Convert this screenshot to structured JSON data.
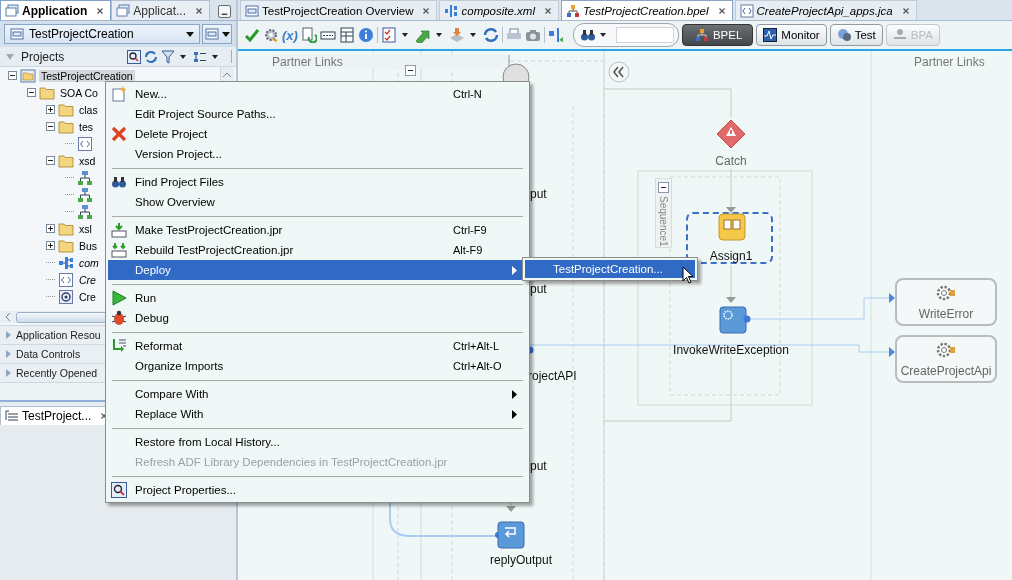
{
  "left_panel": {
    "tabs": [
      {
        "label": "Application",
        "selected": true
      },
      {
        "label": "Applicat...",
        "selected": false
      }
    ],
    "application_selector": {
      "value": "TestProjectCreation"
    },
    "projects_header": {
      "title": "Projects"
    },
    "tree": [
      {
        "label": "TestProjectCreation",
        "kind": "project",
        "expanded": true,
        "selected": true,
        "italic": false,
        "children": [
          {
            "label": "SOA Co",
            "kind": "folder",
            "expanded": true,
            "selected": false,
            "italic": false,
            "children": [
              {
                "label": "clas",
                "kind": "folder",
                "expanded": false,
                "selected": false,
                "italic": false
              },
              {
                "label": "tes",
                "kind": "folder",
                "expanded": true,
                "selected": false,
                "italic": false,
                "children": [
                  {
                    "kind": "source"
                  }
                ]
              },
              {
                "label": "xsd",
                "kind": "folder",
                "expanded": true,
                "selected": false,
                "italic": false,
                "children": [
                  {
                    "kind": "schema"
                  },
                  {
                    "kind": "schema"
                  },
                  {
                    "kind": "schema"
                  }
                ]
              },
              {
                "label": "xsl",
                "kind": "folder",
                "expanded": false,
                "selected": false,
                "italic": false
              },
              {
                "label": "Bus",
                "kind": "folder",
                "expanded": false,
                "selected": false,
                "italic": false
              },
              {
                "label": "com",
                "kind": "composite",
                "selected": false,
                "italic": true
              },
              {
                "label": "Cre",
                "kind": "source",
                "selected": false,
                "italic": true
              },
              {
                "label": "Cre",
                "kind": "adapter",
                "selected": false,
                "italic": false
              }
            ]
          }
        ]
      }
    ],
    "accordion": [
      {
        "label": "Application Resou",
        "expanded": false
      },
      {
        "label": "Data Controls",
        "expanded": false
      },
      {
        "label": "Recently Opened",
        "expanded": false
      }
    ]
  },
  "structure_panel": {
    "tab": "TestProject..."
  },
  "editor": {
    "tabs": [
      {
        "label": "TestProjectCreation Overview",
        "selected": false,
        "italic": false
      },
      {
        "label": "composite.xml",
        "selected": false,
        "italic": true
      },
      {
        "label": "TestProjectCreation.bpel",
        "selected": true,
        "italic": true
      },
      {
        "label": "CreateProjectApi_apps.jca",
        "selected": false,
        "italic": true
      }
    ],
    "toolbar": {
      "variables_label": "(x)",
      "view_buttons": [
        {
          "label": "BPEL",
          "selected": true,
          "disabled": false
        },
        {
          "label": "Monitor",
          "selected": false,
          "disabled": false
        },
        {
          "label": "Test",
          "selected": false,
          "disabled": false
        },
        {
          "label": "BPA",
          "selected": false,
          "disabled": true
        }
      ]
    },
    "canvas": {
      "partner_links_left": {
        "title": "Partner Links"
      },
      "partner_links_right": {
        "title": "Partner Links",
        "items": [
          {
            "label": "WriteError"
          },
          {
            "label": "CreateProjectApi"
          }
        ]
      },
      "partial_labels": [
        "put",
        "put",
        "rojectAPI",
        "put"
      ],
      "catch": {
        "label": "Catch"
      },
      "sequence": {
        "label": "Sequence1",
        "expanded": true
      },
      "assign": {
        "label": "Assign1",
        "selected": true
      },
      "invoke": {
        "label": "InvokeWriteException"
      },
      "reply": {
        "label": "replyOutput"
      }
    }
  },
  "context_menu": {
    "items": [
      {
        "kind": "item",
        "label": "New...",
        "shortcut": "Ctrl-N",
        "selected": false,
        "disabled": false,
        "submenu": false
      },
      {
        "kind": "item",
        "label": "Edit Project Source Paths...",
        "selected": false,
        "disabled": false,
        "submenu": false
      },
      {
        "kind": "item",
        "label": "Delete Project",
        "selected": false,
        "disabled": false,
        "submenu": false
      },
      {
        "kind": "item",
        "label": "Version Project...",
        "selected": false,
        "disabled": false,
        "submenu": false
      },
      {
        "kind": "separator"
      },
      {
        "kind": "item",
        "label": "Find Project Files",
        "selected": false,
        "disabled": false,
        "submenu": false
      },
      {
        "kind": "item",
        "label": "Show Overview",
        "selected": false,
        "disabled": false,
        "submenu": false
      },
      {
        "kind": "separator"
      },
      {
        "kind": "item",
        "label": "Make TestProjectCreation.jpr",
        "shortcut": "Ctrl-F9",
        "selected": false,
        "disabled": false,
        "submenu": false
      },
      {
        "kind": "item",
        "label": "Rebuild TestProjectCreation.jpr",
        "shortcut": "Alt-F9",
        "selected": false,
        "disabled": false,
        "submenu": false
      },
      {
        "kind": "item",
        "label": "Deploy",
        "selected": true,
        "disabled": false,
        "submenu": true
      },
      {
        "kind": "separator"
      },
      {
        "kind": "item",
        "label": "Run",
        "selected": false,
        "disabled": false,
        "submenu": false
      },
      {
        "kind": "item",
        "label": "Debug",
        "selected": false,
        "disabled": false,
        "submenu": false
      },
      {
        "kind": "separator"
      },
      {
        "kind": "item",
        "label": "Reformat",
        "shortcut": "Ctrl+Alt-L",
        "selected": false,
        "disabled": false,
        "submenu": false
      },
      {
        "kind": "item",
        "label": "Organize Imports",
        "shortcut": "Ctrl+Alt-O",
        "selected": false,
        "disabled": false,
        "submenu": false
      },
      {
        "kind": "separator"
      },
      {
        "kind": "item",
        "label": "Compare With",
        "selected": false,
        "disabled": false,
        "submenu": true
      },
      {
        "kind": "item",
        "label": "Replace With",
        "selected": false,
        "disabled": false,
        "submenu": true
      },
      {
        "kind": "separator"
      },
      {
        "kind": "item",
        "label": "Restore from Local History...",
        "selected": false,
        "disabled": false,
        "submenu": false
      },
      {
        "kind": "item",
        "label": "Refresh ADF Library Dependencies in TestProjectCreation.jpr",
        "selected": false,
        "disabled": true,
        "submenu": false
      },
      {
        "kind": "separator"
      },
      {
        "kind": "item",
        "label": "Project Properties...",
        "selected": false,
        "disabled": false,
        "submenu": false
      }
    ]
  },
  "submenu": {
    "items": [
      {
        "label": "TestProjectCreation...",
        "selected": true
      }
    ]
  }
}
